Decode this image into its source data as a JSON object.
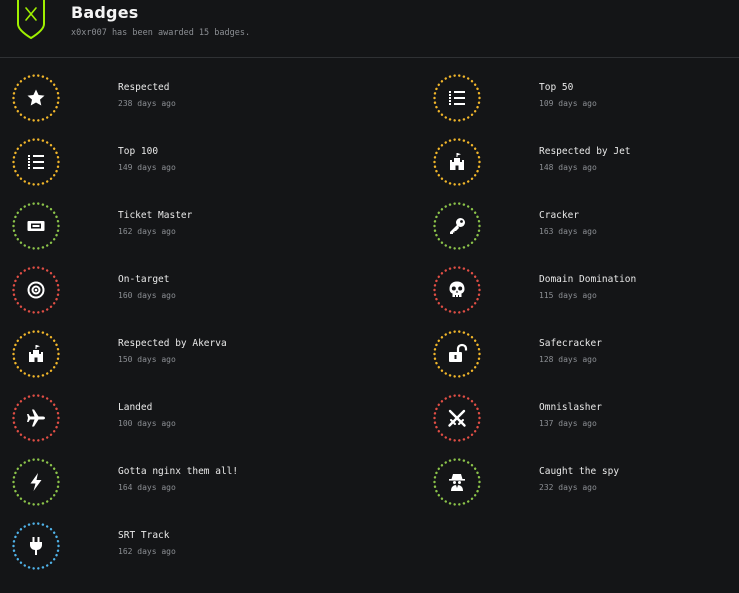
{
  "header": {
    "title": "Badges",
    "subtitle": "x0xr007 has been awarded 15 badges.",
    "shield_icon": "shield-x-icon",
    "shield_color": "#9fef00"
  },
  "colors": {
    "yellow": "#ffaf00",
    "green": "#9fef00",
    "red": "#ff3e3e",
    "blue": "#2ee7b6",
    "cyan": "#5cb3f0"
  },
  "badges": [
    {
      "name": "Respected",
      "ago": "238 days ago",
      "icon": "star-icon",
      "color": "#f0b52a"
    },
    {
      "name": "Top 50",
      "ago": "109 days ago",
      "icon": "list-icon",
      "color": "#f0b52a"
    },
    {
      "name": "Top 100",
      "ago": "149 days ago",
      "icon": "list-icon",
      "color": "#f0b52a"
    },
    {
      "name": "Respected by Jet",
      "ago": "148 days ago",
      "icon": "castle-icon",
      "color": "#f0b52a"
    },
    {
      "name": "Ticket Master",
      "ago": "162 days ago",
      "icon": "ticket-icon",
      "color": "#8bc34a"
    },
    {
      "name": "Cracker",
      "ago": "163 days ago",
      "icon": "key-icon",
      "color": "#8bc34a"
    },
    {
      "name": "On-target",
      "ago": "160 days ago",
      "icon": "target-icon",
      "color": "#e04e45"
    },
    {
      "name": "Domain Domination",
      "ago": "115 days ago",
      "icon": "skull-icon",
      "color": "#e04e45"
    },
    {
      "name": "Respected by Akerva",
      "ago": "150 days ago",
      "icon": "castle-icon",
      "color": "#f0b52a"
    },
    {
      "name": "Safecracker",
      "ago": "128 days ago",
      "icon": "unlock-icon",
      "color": "#f0b52a"
    },
    {
      "name": "Landed",
      "ago": "100 days ago",
      "icon": "plane-icon",
      "color": "#e04e45"
    },
    {
      "name": "Omnislasher",
      "ago": "137 days ago",
      "icon": "swords-icon",
      "color": "#e04e45"
    },
    {
      "name": "Gotta nginx them all!",
      "ago": "164 days ago",
      "icon": "bolt-icon",
      "color": "#8bc34a"
    },
    {
      "name": "Caught the spy",
      "ago": "232 days ago",
      "icon": "spy-icon",
      "color": "#8bc34a"
    },
    {
      "name": "SRT Track",
      "ago": "162 days ago",
      "icon": "plug-icon",
      "color": "#4fb2e8"
    }
  ]
}
